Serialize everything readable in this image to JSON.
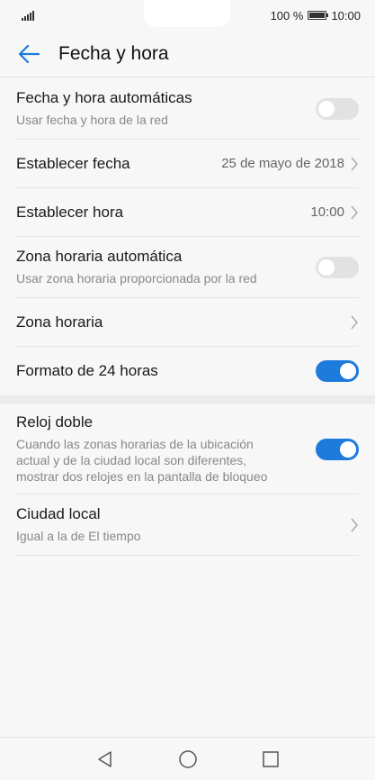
{
  "status_bar": {
    "battery_text": "100 %",
    "time": "10:00",
    "signal_icon": "signal-icon",
    "battery_icon": "battery-icon"
  },
  "app_bar": {
    "title": "Fecha y hora",
    "back_icon": "arrow-left-icon",
    "accent_color": "#1d7bdb"
  },
  "settings": {
    "auto_datetime": {
      "title": "Fecha y hora automáticas",
      "subtitle": "Usar fecha y hora de la red",
      "enabled": false
    },
    "set_date": {
      "title": "Establecer fecha",
      "value": "25 de mayo de 2018"
    },
    "set_time": {
      "title": "Establecer hora",
      "value": "10:00"
    },
    "auto_timezone": {
      "title": "Zona horaria automática",
      "subtitle": "Usar zona horaria proporcionada por la red",
      "enabled": false
    },
    "timezone": {
      "title": "Zona horaria"
    },
    "format_24h": {
      "title": "Formato de 24 horas",
      "enabled": true
    },
    "dual_clock": {
      "title": "Reloj doble",
      "subtitle_line1": "Cuando las zonas horarias de la ubicación",
      "subtitle_line2": "actual y de la ciudad local son diferentes,",
      "subtitle_line3": "mostrar dos relojes en la pantalla de bloqueo",
      "enabled": true
    },
    "home_city": {
      "title": "Ciudad local",
      "subtitle": "Igual a la de El tiempo"
    }
  },
  "nav_bar": {
    "back_icon": "triangle-back-icon",
    "home_icon": "circle-home-icon",
    "recents_icon": "square-recents-icon"
  }
}
